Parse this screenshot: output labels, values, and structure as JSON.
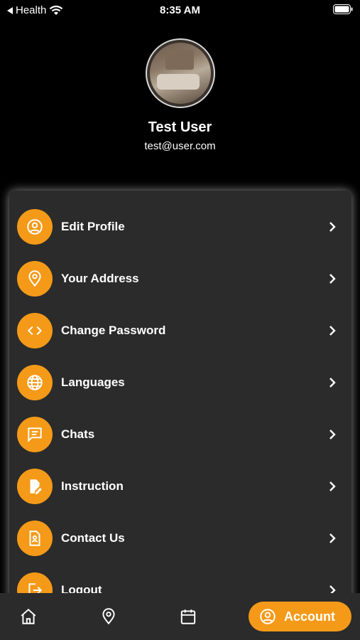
{
  "status_bar": {
    "back_app": "Health",
    "time": "8:35 AM"
  },
  "profile": {
    "name": "Test User",
    "email": "test@user.com"
  },
  "menu": {
    "items": [
      {
        "label": "Edit Profile",
        "icon": "user-circle-icon"
      },
      {
        "label": "Your Address",
        "icon": "location-pin-icon"
      },
      {
        "label": "Change Password",
        "icon": "code-brackets-icon"
      },
      {
        "label": "Languages",
        "icon": "globe-icon"
      },
      {
        "label": "Chats",
        "icon": "chat-icon"
      },
      {
        "label": "Instruction",
        "icon": "document-edit-icon"
      },
      {
        "label": "Contact Us",
        "icon": "contact-document-icon"
      },
      {
        "label": "Logout",
        "icon": "logout-icon"
      }
    ]
  },
  "bottom_nav": {
    "items": [
      "home-icon",
      "location-pin-icon",
      "calendar-icon"
    ],
    "active_label": "Account"
  },
  "colors": {
    "accent": "#f49a18",
    "card": "#2b2b2b",
    "background": "#000000"
  }
}
